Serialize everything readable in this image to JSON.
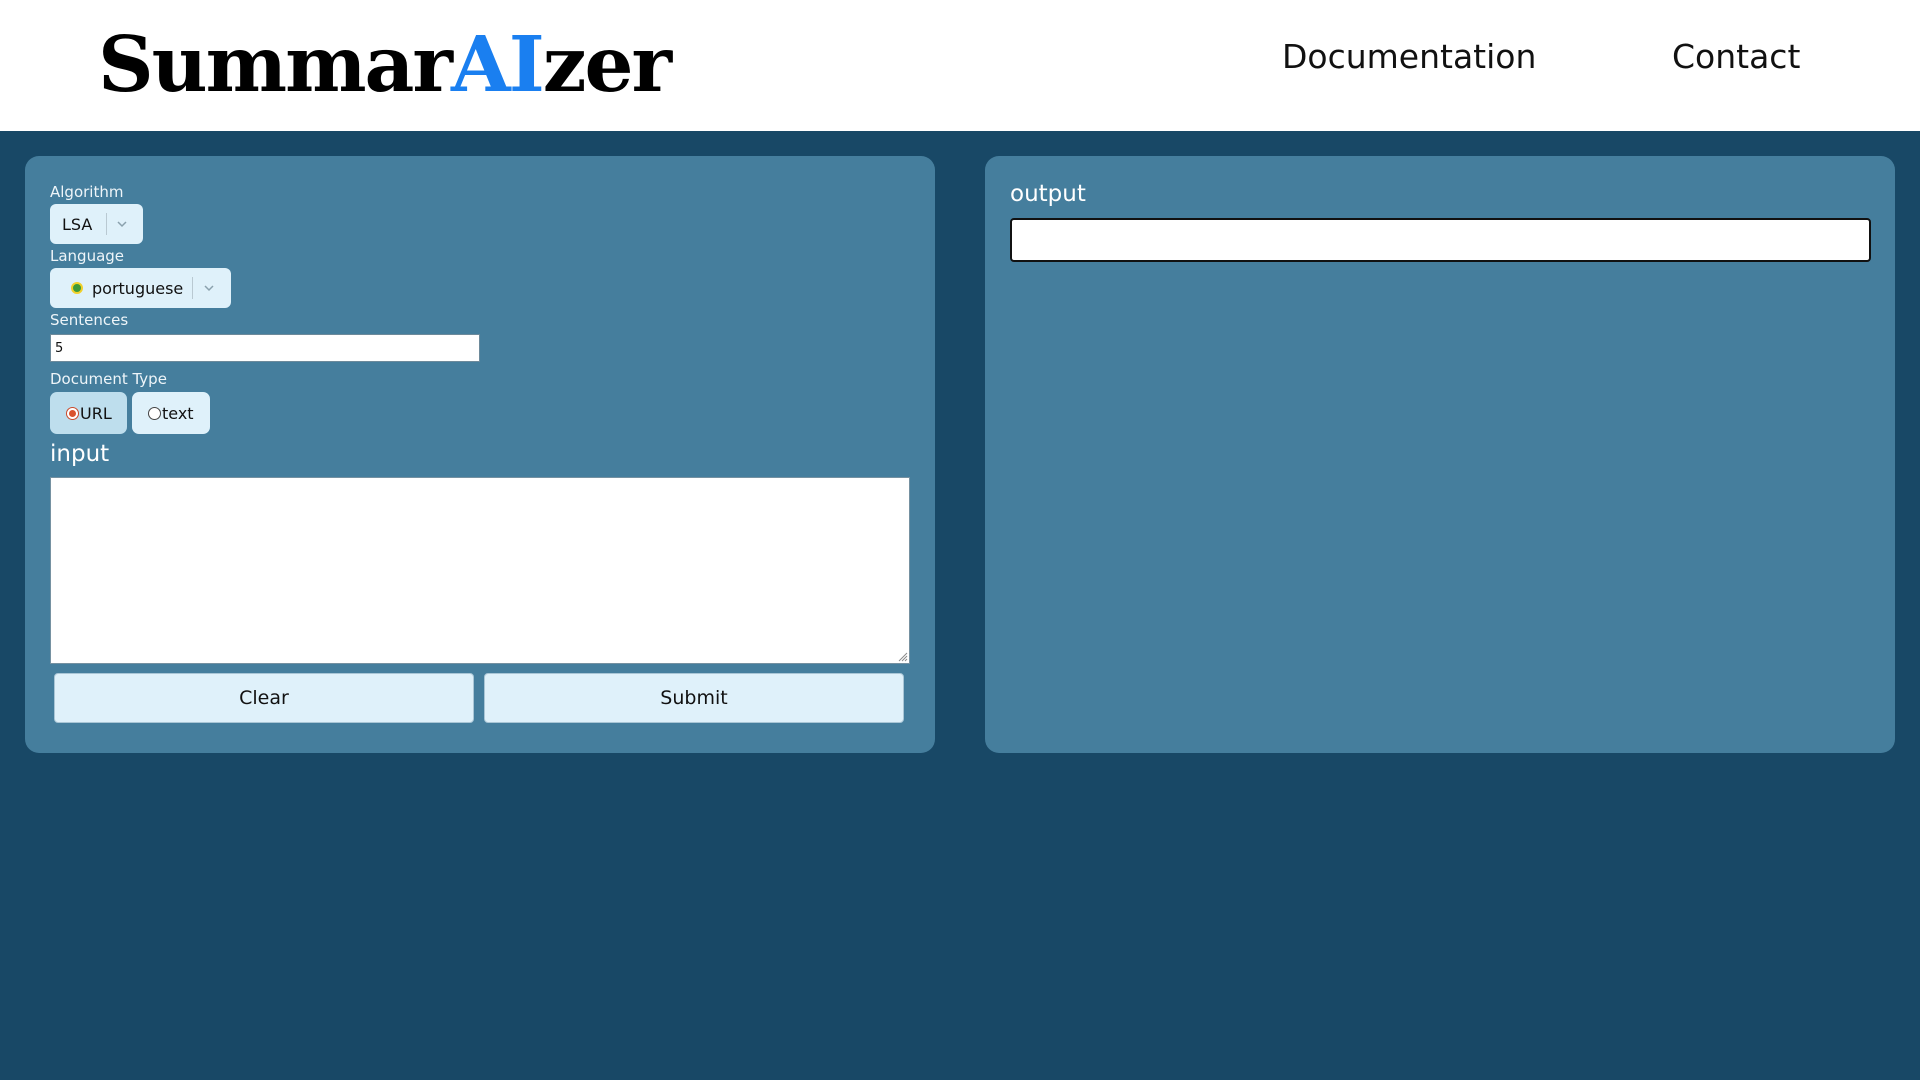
{
  "header": {
    "logo_prefix": "Summar",
    "logo_highlight": "AI",
    "logo_suffix": "zer",
    "nav": [
      {
        "label": "Documentation"
      },
      {
        "label": "Contact"
      }
    ]
  },
  "form": {
    "algorithm": {
      "label": "Algorithm",
      "value": "LSA"
    },
    "language": {
      "label": "Language",
      "value": "portuguese"
    },
    "sentences": {
      "label": "Sentences",
      "value": "5"
    },
    "document_type": {
      "label": "Document Type",
      "options": [
        {
          "label": "URL",
          "selected": true
        },
        {
          "label": "text",
          "selected": false
        }
      ]
    },
    "input": {
      "label": "input",
      "value": ""
    },
    "buttons": {
      "clear": "Clear",
      "submit": "Submit"
    }
  },
  "output": {
    "label": "output",
    "value": ""
  },
  "colors": {
    "page_background": "#184866",
    "panel_background": "#457e9d",
    "accent": "#1a7ff0",
    "button_background": "#dff1fa",
    "selected_radio_background": "#bedeed"
  },
  "icons": [
    "chevron-down-icon",
    "brazil-flag-icon",
    "resize-grip-icon"
  ]
}
